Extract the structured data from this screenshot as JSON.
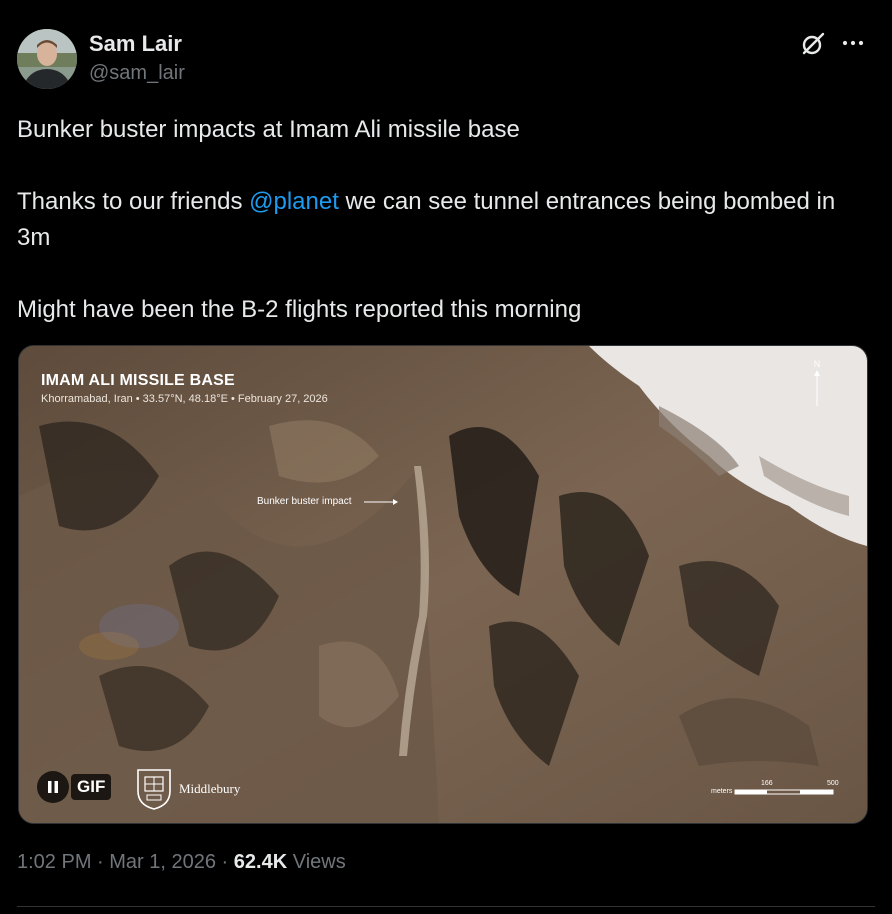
{
  "author": {
    "name": "Sam Lair",
    "handle": "@sam_lair"
  },
  "icons": {
    "grok": "grok-icon",
    "more": "more-icon",
    "pause": "pause-icon"
  },
  "tweet": {
    "line1": "Bunker buster impacts at Imam Ali missile base",
    "line2_before": "Thanks to our friends ",
    "mention": "@planet",
    "line2_after": " we can see tunnel entrances being bombed in 3m",
    "line3": "Might have been the B-2 flights reported this morning"
  },
  "media": {
    "title": "IMAM ALI MISSILE BASE",
    "subtitle": "Khorramabad, Iran • 33.57°N, 48.18°E • February 27, 2026",
    "impact_label": "Bunker buster impact",
    "north_label": "N",
    "gif_label": "GIF",
    "logo_name": "Middlebury",
    "scale": {
      "unit": "meters",
      "mid": "166",
      "end": "500"
    }
  },
  "meta": {
    "time": "1:02 PM",
    "sep1": " · ",
    "date": "Mar 1, 2026",
    "sep2": " · ",
    "views_count": "62.4K",
    "views_label": " Views"
  },
  "colors": {
    "background": "#000000",
    "text": "#e7e9ea",
    "muted": "#71767b",
    "link": "#1d9bf0"
  }
}
